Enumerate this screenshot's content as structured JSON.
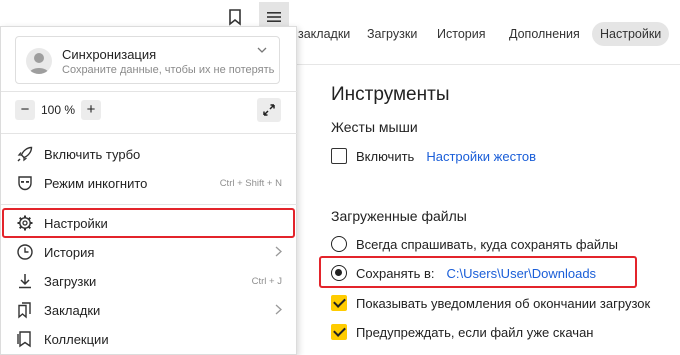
{
  "tabs": [
    {
      "label": "закладки"
    },
    {
      "label": "Загрузки"
    },
    {
      "label": "История"
    },
    {
      "label": "Дополнения"
    },
    {
      "label": "Настройки"
    }
  ],
  "settings": {
    "section_title": "Инструменты",
    "mouse_gestures": {
      "title": "Жесты мыши",
      "enable_label": "Включить",
      "settings_link": "Настройки жестов",
      "enabled": false
    },
    "downloads": {
      "title": "Загруженные файлы",
      "always_ask_label": "Всегда спрашивать, куда сохранять файлы",
      "save_to_label": "Сохранять в:",
      "save_path": "C:\\Users\\User\\Downloads",
      "selected_option": "save_to",
      "notify_label": "Показывать уведомления об окончании загрузок",
      "notify_checked": true,
      "warn_label": "Предупреждать, если файл уже скачан",
      "warn_checked": true
    }
  },
  "menu": {
    "sync": {
      "title": "Синхронизация",
      "subtitle": "Сохраните данные, чтобы их не потерять"
    },
    "zoom": {
      "minus": "−",
      "value": "100 %",
      "plus": "+"
    },
    "items": [
      {
        "label": "Включить турбо",
        "icon": "rocket-icon"
      },
      {
        "label": "Режим инкогнито",
        "icon": "incognito-icon",
        "hint": "Ctrl + Shift + N"
      },
      {
        "label": "Настройки",
        "icon": "gear-icon"
      },
      {
        "label": "История",
        "icon": "clock-icon",
        "has_submenu": true
      },
      {
        "label": "Загрузки",
        "icon": "download-icon",
        "hint": "Ctrl + J"
      },
      {
        "label": "Закладки",
        "icon": "bookmarks-icon",
        "has_submenu": true
      },
      {
        "label": "Коллекции",
        "icon": "collections-icon"
      }
    ]
  },
  "colors": {
    "highlight": "#e3242b",
    "checkbox_accent": "#ffcc00",
    "link": "#1a5ed8"
  }
}
